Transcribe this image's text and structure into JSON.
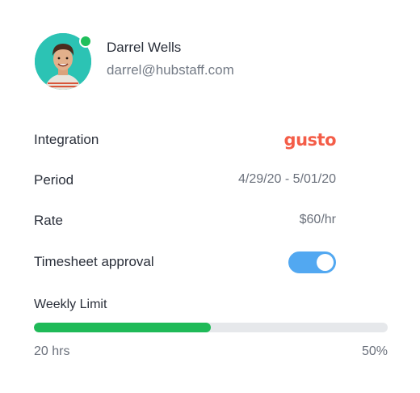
{
  "user": {
    "name": "Darrel Wells",
    "email": "darrel@hubstaff.com",
    "status": "online",
    "status_color": "#1fbf5b"
  },
  "details": {
    "integration_label": "Integration",
    "integration_logo_text": "gusto",
    "integration_brand_color": "#f45d48",
    "period_label": "Period",
    "period_value": "4/29/20 - 5/01/20",
    "rate_label": "Rate",
    "rate_value": "$60/hr",
    "approval_label": "Timesheet approval",
    "approval_enabled": true,
    "toggle_color": "#52a8f1"
  },
  "weekly_limit": {
    "label": "Weekly Limit",
    "hours": "20 hrs",
    "percent_label": "50%",
    "progress": 0.5,
    "bar_color": "#1fba58"
  }
}
